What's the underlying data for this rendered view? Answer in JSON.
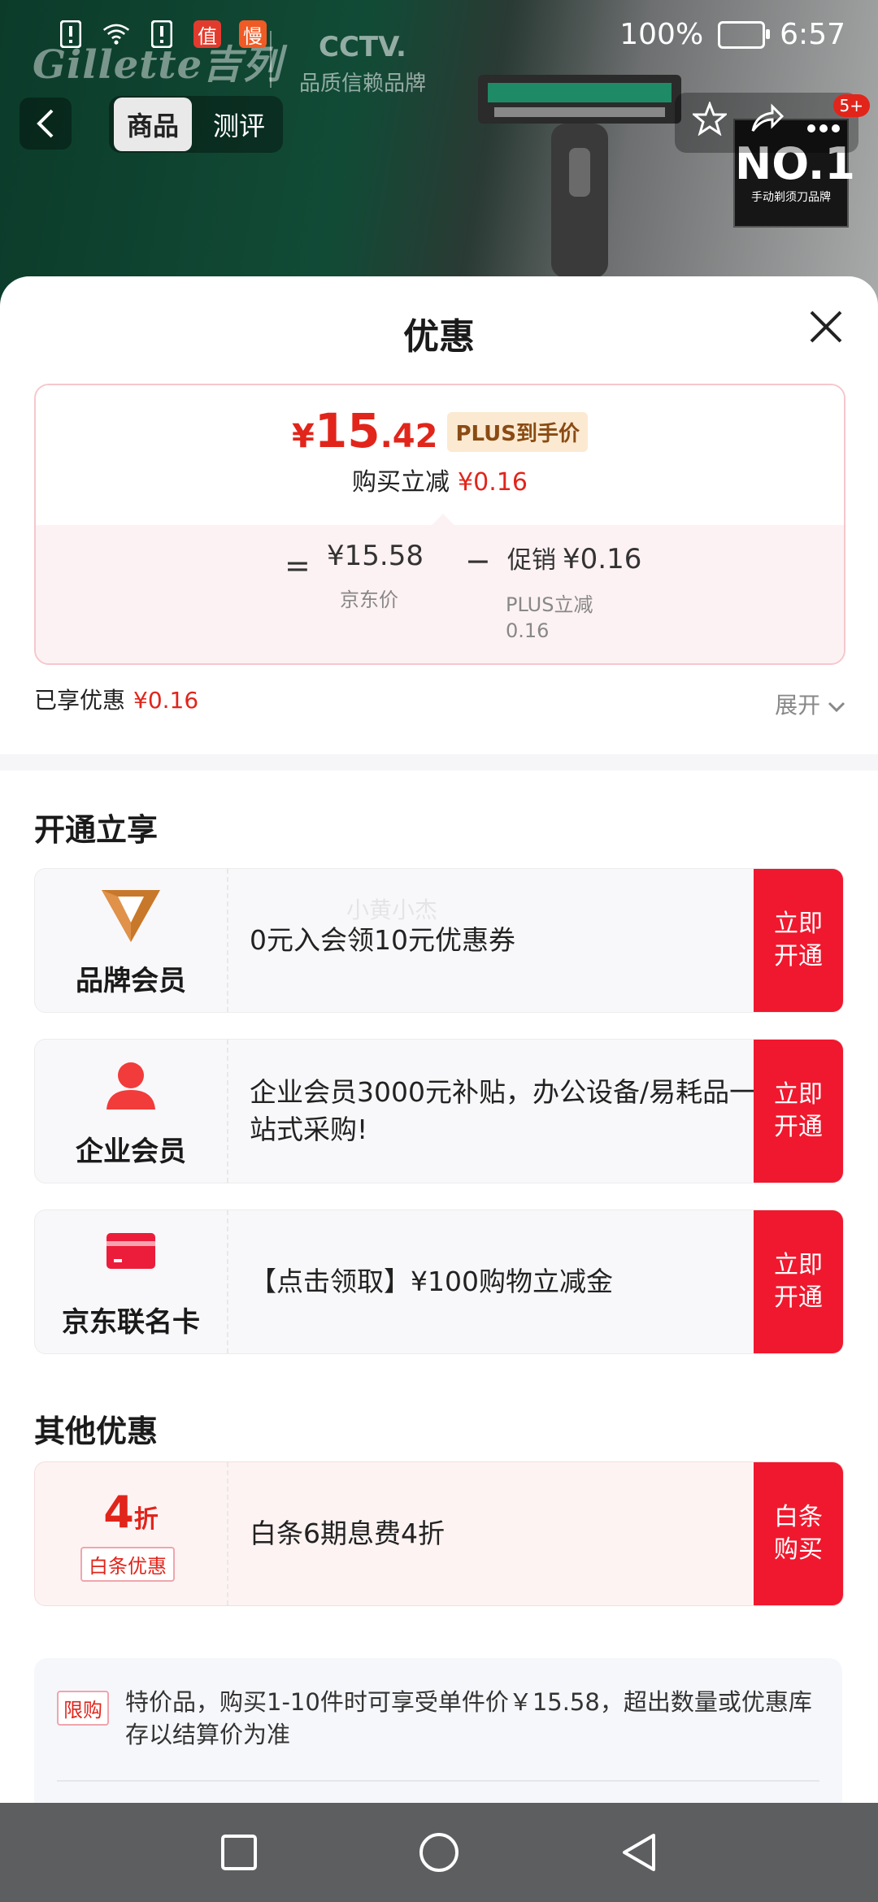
{
  "status": {
    "battery": "100%",
    "time": "6:57",
    "app_badges": [
      "值",
      "慢"
    ]
  },
  "hero": {
    "brand": "Gillette吉列",
    "cctv_title": "CCTV.",
    "cctv_sub": "品质信赖品牌",
    "tabs": [
      {
        "label": "商品",
        "active": true
      },
      {
        "label": "测评",
        "active": false
      }
    ],
    "badge_count": "5+",
    "award_big": "NO.1",
    "award_small": "手动剃须刀品牌"
  },
  "sheet": {
    "title": "优惠",
    "price": {
      "currency": "¥",
      "final_int": "15",
      "final_dec": ".42",
      "plus_tag": "PLUS到手价",
      "reduce_label": "购买立减",
      "reduce_value": "¥0.16",
      "eq": "=",
      "jd_price": "¥15.58",
      "jd_label": "京东价",
      "minus": "−",
      "promo_label": "促销",
      "promo_value": "¥0.16",
      "promo_sub_1": "PLUS立减",
      "promo_sub_2": "0.16"
    },
    "enjoyed_label": "已享优惠",
    "enjoyed_value": "¥0.16",
    "expand_label": "展开",
    "open_section_title": "开通立享",
    "offers": [
      {
        "name": "品牌会员",
        "text": "0元入会领10元优惠券",
        "button": "立即\n开通",
        "icon": "brand-v-icon"
      },
      {
        "name": "企业会员",
        "text": " 企业会员3000元补贴，办公设备/易耗品一站式采购!",
        "button": "立即\n开通",
        "icon": "person-icon"
      },
      {
        "name": "京东联名卡",
        "text": "【点击领取】¥100购物立减金",
        "button": "立即\n开通",
        "icon": "credit-card-icon"
      }
    ],
    "other_section_title": "其他优惠",
    "baitiao": {
      "discount_num": "4",
      "discount_unit": "折",
      "tag": "白条优惠",
      "text": "白条6期息费4折",
      "button": "白条\n购买"
    },
    "note": {
      "tag": "限购",
      "text": "特价品，购买1-10件时可享受单件价￥15.58，超出数量或优惠库存以结算价为准"
    },
    "watermark": "小黄小杰"
  },
  "colors": {
    "accent_red": "#e1251b",
    "button_red": "#f0182e",
    "plus_gold_bg": "#fbead1"
  }
}
